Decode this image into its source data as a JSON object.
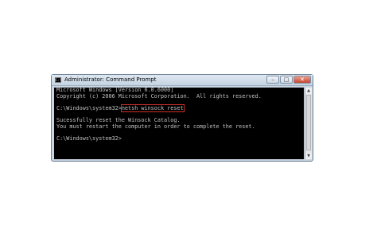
{
  "window": {
    "title": "Administrator: Command Prompt",
    "app_icon_glyph": "C:\\",
    "min_glyph": "–",
    "max_glyph": "□",
    "close_glyph": "✕"
  },
  "console": {
    "line1": "Microsoft Windows [Version 6.0.6000]",
    "line2": "Copyright (c) 2006 Microsoft Corporation.  All rights reserved.",
    "prompt1": "C:\\Windows\\system32>",
    "command": "netsh winsock reset",
    "result1": "Sucessfully reset the Winsock Catalog.",
    "result2": "You must restart the computer in order to complete the reset.",
    "prompt2": "C:\\Windows\\system32>"
  },
  "scrollbar": {
    "up_glyph": "▲",
    "down_glyph": "▼"
  }
}
